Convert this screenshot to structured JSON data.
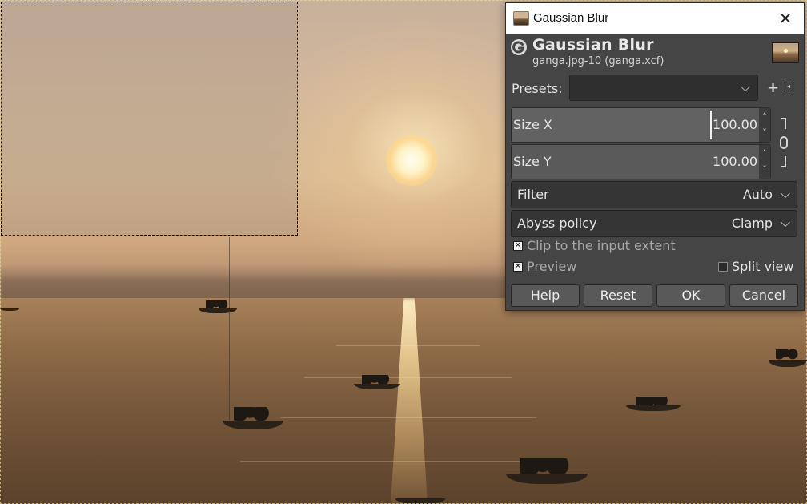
{
  "dialog": {
    "window_title": "Gaussian Blur",
    "close_glyph": "✕",
    "header_title": "Gaussian Blur",
    "header_subtitle": "ganga.jpg-10 (ganga.xcf)",
    "presets": {
      "label": "Presets:",
      "value": "",
      "add_glyph": "+"
    },
    "size_x": {
      "label": "Size X",
      "value": "100.00"
    },
    "size_y": {
      "label": "Size Y",
      "value": "100.00"
    },
    "chain_linked": true,
    "filter": {
      "label": "Filter",
      "value": "Auto"
    },
    "abyss_policy": {
      "label": "Abyss policy",
      "value": "Clamp"
    },
    "clip_to_input_extent": {
      "label": "Clip to the input extent",
      "checked": true
    },
    "preview": {
      "label": "Preview",
      "checked": true
    },
    "split_view": {
      "label": "Split view",
      "checked": false
    },
    "buttons": {
      "help": "Help",
      "reset": "Reset",
      "ok": "OK",
      "cancel": "Cancel"
    },
    "icons": {
      "app": "gimp-logo-icon",
      "chain": "chain-link-icon",
      "menu": "presets-menu-icon"
    }
  },
  "canvas": {
    "image": "sunrise-over-river-with-boats",
    "selection": "rectangle-selection"
  },
  "colors": {
    "dialog_bg": "#454545",
    "titlebar_bg": "#ffffff",
    "field_bg": "#5a5a5a"
  }
}
